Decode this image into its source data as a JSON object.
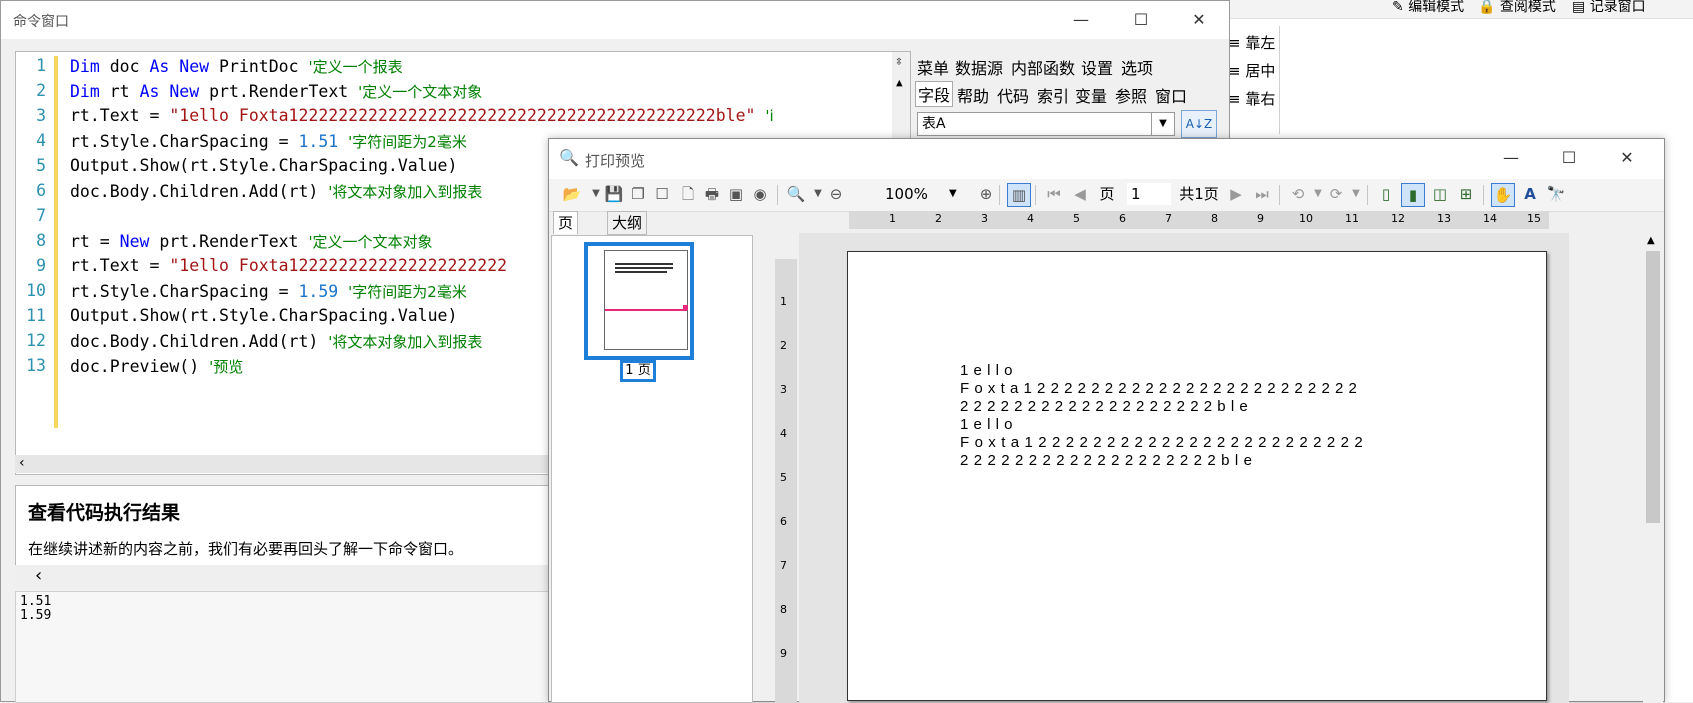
{
  "background_app": {
    "toolbar": [
      "编辑模式",
      "查阅模式",
      "记录窗口"
    ],
    "side_items": [
      "靠左",
      "居中",
      "靠右"
    ]
  },
  "command_window": {
    "title": "命令窗口",
    "controls": {
      "minimize": "—",
      "maximize": "☐",
      "close": "✕"
    },
    "code_lines": [
      {
        "n": "1",
        "text": "Dim doc As New PrintDoc",
        "comment": "'定义一个报表"
      },
      {
        "n": "2",
        "text": "Dim rt As New prt.RenderText",
        "comment": "'定义一个文本对象"
      },
      {
        "n": "3",
        "text": "rt.Text = \"1ello Foxta1222222222222222222222222222222222222222222ble\"",
        "comment": "'i"
      },
      {
        "n": "4",
        "text": "rt.Style.CharSpacing = 1.51",
        "comment": "'字符间距为2毫米"
      },
      {
        "n": "5",
        "text": "Output.Show(rt.Style.CharSpacing.Value)",
        "comment": ""
      },
      {
        "n": "6",
        "text": "doc.Body.Children.Add(rt)",
        "comment": "'将文本对象加入到报表"
      },
      {
        "n": "7",
        "text": "",
        "comment": ""
      },
      {
        "n": "8",
        "text": "rt = New prt.RenderText",
        "comment": "'定义一个文本对象"
      },
      {
        "n": "9",
        "text": "rt.Text = \"1ello Foxta1222222222222222222222",
        "comment": ""
      },
      {
        "n": "10",
        "text": "rt.Style.CharSpacing = 1.59",
        "comment": "'字符间距为2毫米"
      },
      {
        "n": "11",
        "text": "Output.Show(rt.Style.CharSpacing.Value)",
        "comment": ""
      },
      {
        "n": "12",
        "text": "doc.Body.Children.Add(rt)",
        "comment": "'将文本对象加入到报表"
      },
      {
        "n": "13",
        "text": "doc.Preview()",
        "comment": "'预览"
      }
    ],
    "right_panel": {
      "row1": [
        "菜单",
        "数据源",
        "内部函数",
        "设置",
        "选项"
      ],
      "row2": [
        "字段",
        "帮助",
        "代码",
        "索引",
        "变量",
        "参照",
        "窗口"
      ],
      "table_select": "表A"
    },
    "doc_panel": {
      "heading": "查看代码执行结果",
      "text": "在继续讲述新的内容之前，我们有必要再回头了解一下命令窗口。"
    },
    "output": [
      "1.51",
      "1.59"
    ]
  },
  "print_preview": {
    "title": "打印预览",
    "controls": {
      "minimize": "—",
      "maximize": "☐",
      "close": "✕"
    },
    "toolbar": {
      "zoom": "100%",
      "page_label": "页",
      "page_value": "1",
      "total_pages": "共1页"
    },
    "tabs": [
      "页",
      "大纲"
    ],
    "thumb_label": "1 页",
    "ruler_numbers": [
      "1",
      "2",
      "3",
      "4",
      "5",
      "6",
      "7",
      "8",
      "9",
      "10",
      "11",
      "12",
      "13",
      "14",
      "15"
    ],
    "vruler_numbers": [
      "1",
      "2",
      "3",
      "4",
      "5",
      "6",
      "7",
      "8",
      "9"
    ],
    "page_lines": [
      "1ello",
      "Foxta1222222222222222222222222",
      "2222222222222222222ble",
      "1ello",
      "Foxta1222222222222222222222222",
      "2222222222222222222ble"
    ]
  },
  "colors": {
    "keyword": "#0000ff",
    "string": "#a31515",
    "comment": "#008000",
    "number": "#098658",
    "line_number": "#2b91af",
    "selection_blue": "#1e7fd8"
  }
}
